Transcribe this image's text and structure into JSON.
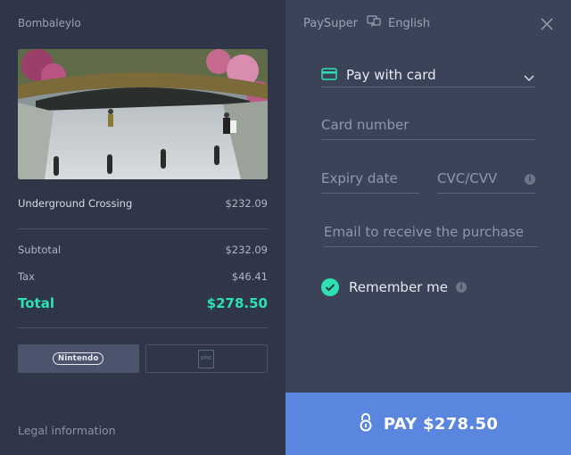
{
  "merchant": "Bombaleylo",
  "product": {
    "name": "Underground Crossing",
    "price": "$232.09"
  },
  "summary": {
    "subtotal_label": "Subtotal",
    "subtotal": "$232.09",
    "tax_label": "Tax",
    "tax": "$46.41",
    "total_label": "Total",
    "total": "$278.50"
  },
  "platforms": [
    {
      "name": "Nintendo",
      "logo_text": "Nintendo",
      "selected": true
    },
    {
      "name": "Epic Games",
      "logo_text": "EPIC",
      "selected": false
    }
  ],
  "legal_label": "Legal information",
  "topbar": {
    "brand": "PaySuper",
    "language": "English"
  },
  "payment_method": {
    "label": "Pay with card",
    "icon": "card-icon"
  },
  "fields": {
    "card_number_placeholder": "Card number",
    "expiry_placeholder": "Expiry date",
    "cvc_placeholder": "CVC/CVV",
    "email_placeholder": "Email to receive the purchase"
  },
  "remember": {
    "label": "Remember me",
    "checked": true
  },
  "pay_button": {
    "label": "PAY $278.50"
  },
  "colors": {
    "accent_green": "#2fe0b1",
    "pay_blue": "#5a86e0",
    "left_bg": "#2f3648",
    "right_bg": "#3b4359"
  }
}
